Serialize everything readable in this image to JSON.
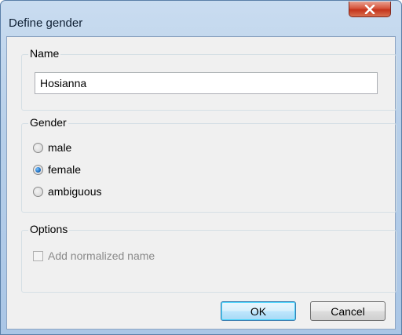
{
  "window": {
    "title": "Define gender"
  },
  "name_group": {
    "label": "Name",
    "value": "Hosianna"
  },
  "gender_group": {
    "label": "Gender",
    "options": [
      {
        "label": "male",
        "checked": false
      },
      {
        "label": "female",
        "checked": true
      },
      {
        "label": "ambiguous",
        "checked": false
      }
    ]
  },
  "options_group": {
    "label": "Options",
    "normalized_label": "Add normalized name",
    "normalized_checked": false,
    "normalized_enabled": false
  },
  "buttons": {
    "ok": "OK",
    "cancel": "Cancel"
  },
  "icons": {
    "close": "close-icon",
    "radio": "radio-icon",
    "checkbox": "checkbox-icon"
  }
}
